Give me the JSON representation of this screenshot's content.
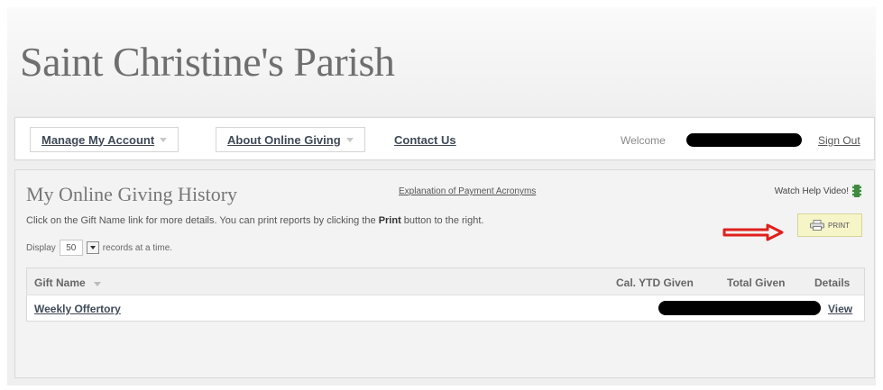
{
  "header": {
    "title": "Saint Christine's Parish"
  },
  "nav": {
    "manage_account": "Manage My Account",
    "about_giving": "About Online Giving",
    "contact": "Contact Us",
    "welcome": "Welcome",
    "sign_out": "Sign Out"
  },
  "panel": {
    "title": "My Online Giving History",
    "acronyms_link": "Explanation of Payment Acronyms",
    "help_video": "Watch Help Video!",
    "instructions_pre": "Click on the Gift Name link for more details. You can print reports by clicking the ",
    "instructions_bold": "Print",
    "instructions_post": " button to the right.",
    "print_label": "PRINT",
    "display_pre": "Display",
    "display_value": "50",
    "display_post": "records at a time."
  },
  "table": {
    "columns": [
      "Gift Name",
      "Cal. YTD Given",
      "Total Given",
      "Details"
    ],
    "rows": [
      {
        "gift_name": "Weekly Offertory",
        "details": "View"
      }
    ]
  },
  "colors": {
    "arrow": "#e0201c",
    "print_bg": "#f6f5c8",
    "link": "#3f4a57"
  }
}
